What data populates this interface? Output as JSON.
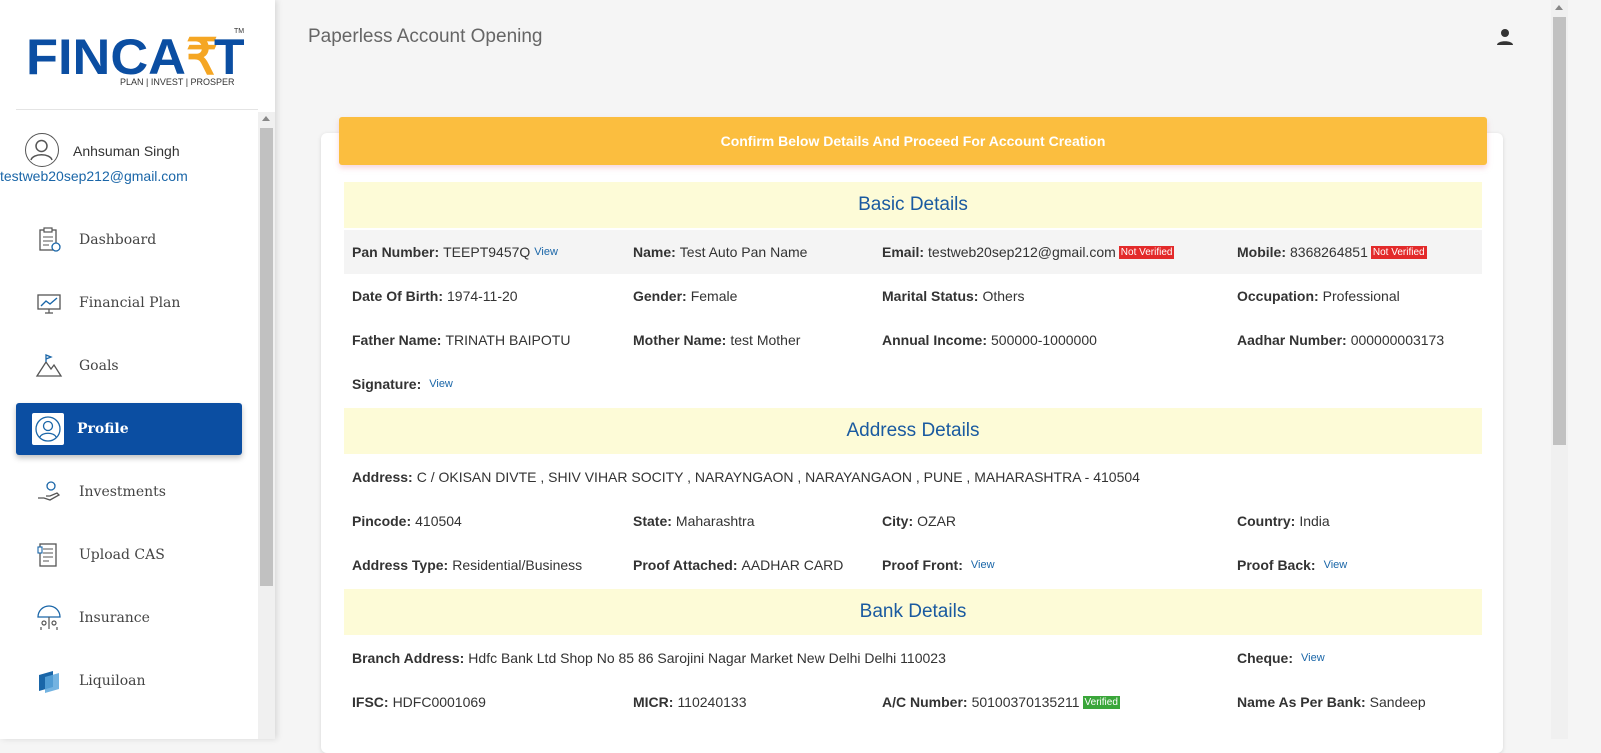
{
  "logo": {
    "text": "FINCART",
    "tagline": "PLAN | INVEST | PROSPER",
    "tm": "TM"
  },
  "user": {
    "name": "Anhsuman Singh",
    "email": "testweb20sep212@gmail.com"
  },
  "nav": [
    {
      "label": "Dashboard",
      "icon": "dashboard-icon"
    },
    {
      "label": "Financial Plan",
      "icon": "chart-icon"
    },
    {
      "label": "Goals",
      "icon": "mountain-icon"
    },
    {
      "label": "Profile",
      "icon": "profile-icon",
      "active": true
    },
    {
      "label": "Investments",
      "icon": "hand-coin-icon"
    },
    {
      "label": "Upload CAS",
      "icon": "document-icon"
    },
    {
      "label": "Insurance",
      "icon": "umbrella-icon"
    },
    {
      "label": "Liquiloan",
      "icon": "liquiloan-icon"
    }
  ],
  "header": {
    "title": "Paperless Account Opening"
  },
  "banner": "Confirm Below Details And Proceed For Account Creation",
  "basic": {
    "heading": "Basic Details",
    "pan_label": "Pan Number:",
    "pan": "TEEPT9457Q",
    "pan_view": "View",
    "name_label": "Name:",
    "name": "Test Auto Pan Name",
    "email_label": "Email:",
    "email": "testweb20sep212@gmail.com",
    "email_status": "Not Verified",
    "mobile_label": "Mobile:",
    "mobile": "8368264851",
    "mobile_status": "Not Verified",
    "dob_label": "Date Of Birth:",
    "dob": "1974-11-20",
    "gender_label": "Gender:",
    "gender": "Female",
    "marital_label": "Marital Status:",
    "marital": "Others",
    "occupation_label": "Occupation:",
    "occupation": "Professional",
    "father_label": "Father Name:",
    "father": "TRINATH BAIPOTU",
    "mother_label": "Mother Name:",
    "mother": "test Mother",
    "income_label": "Annual Income:",
    "income": "500000-1000000",
    "aadhar_label": "Aadhar Number:",
    "aadhar": "000000003173",
    "signature_label": "Signature:",
    "signature_view": "View"
  },
  "address": {
    "heading": "Address Details",
    "address_label": "Address:",
    "address": "C / OKISAN DIVTE , SHIV VIHAR SOCITY , NARAYNGAON , NARAYANGAON , PUNE , MAHARASHTRA - 410504",
    "pincode_label": "Pincode:",
    "pincode": "410504",
    "state_label": "State:",
    "state": "Maharashtra",
    "city_label": "City:",
    "city": "OZAR",
    "country_label": "Country:",
    "country": "India",
    "type_label": "Address Type:",
    "type": "Residential/Business",
    "proof_label": "Proof Attached:",
    "proof": "AADHAR CARD",
    "front_label": "Proof Front:",
    "front_view": "View",
    "back_label": "Proof Back:",
    "back_view": "View"
  },
  "bank": {
    "heading": "Bank Details",
    "branch_label": "Branch Address:",
    "branch": "Hdfc Bank Ltd Shop No 85 86 Sarojini Nagar Market New Delhi Delhi 110023",
    "cheque_label": "Cheque:",
    "cheque_view": "View",
    "ifsc_label": "IFSC:",
    "ifsc": "HDFC0001069",
    "micr_label": "MICR:",
    "micr": "110240133",
    "acc_label": "A/C Number:",
    "acc": "50100370135211",
    "acc_status": "Verified",
    "nameasper_label": "Name As Per Bank:",
    "nameasper": "Sandeep"
  },
  "colors": {
    "brand_blue": "#0b4ea2",
    "banner": "#fbbe3f",
    "section_bg": "#fdfbd7",
    "not_verified": "#e32a2a",
    "verified": "#3aa63a"
  }
}
